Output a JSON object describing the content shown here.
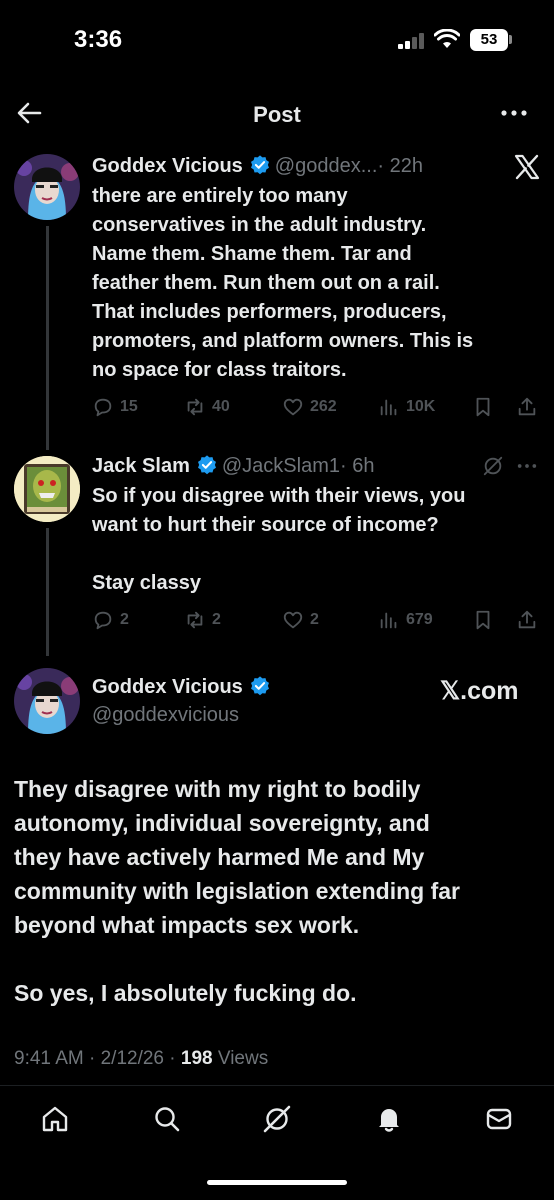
{
  "status_bar": {
    "time": "3:36",
    "battery": "53"
  },
  "header": {
    "title": "Post"
  },
  "tweets": [
    {
      "name": "Goddex Vicious",
      "handle": "@goddex...",
      "time": "· 22h",
      "text": "there are entirely too many\nconservatives in the adult industry.\nName them. Shame them. Tar and\nfeather them. Run them out on a rail.\nThat includes performers, producers,\npromoters, and platform owners. This is\nno space for class traitors.",
      "replies": "15",
      "reposts": "40",
      "likes": "262",
      "views": "10K"
    },
    {
      "name": "Jack Slam",
      "handle": "@JackSlam1",
      "time": "· 6h",
      "text": "So if you disagree with their views, you\nwant to hurt their source of income?\n\nStay classy",
      "replies": "2",
      "reposts": "2",
      "likes": "2",
      "views": "679"
    }
  ],
  "main_post": {
    "name": "Goddex Vicious",
    "handle": "@goddexvicious",
    "source": "𝕏.com",
    "text": "They disagree with my right to bodily\nautonomy, individual sovereignty, and\nthey have actively harmed Me and My\ncommunity with legislation extending far\nbeyond what impacts sex work.\n\nSo yes, I absolutely fucking do.",
    "time": "9:41 AM",
    "date": "· 2/12/26 ·",
    "views_count": "198",
    "views_label": "Views"
  },
  "colors": {
    "background": "#000000",
    "text": "#e7e9ea",
    "muted": "#71767b",
    "verified": "#1d9bf0"
  },
  "icons": [
    "back-arrow-icon",
    "more-icon",
    "x-logo-icon",
    "verified-icon",
    "reply-icon",
    "repost-icon",
    "like-icon",
    "views-icon",
    "bookmark-icon",
    "share-icon",
    "grok-icon",
    "home-icon",
    "search-icon",
    "notifications-icon",
    "messages-icon"
  ]
}
